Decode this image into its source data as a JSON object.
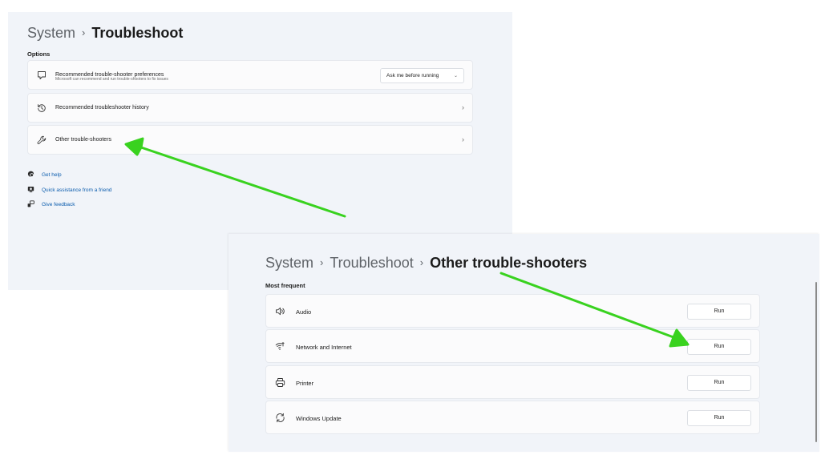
{
  "panel_a": {
    "breadcrumb": {
      "root": "System",
      "separator": "›",
      "current": "Troubleshoot"
    },
    "section_label": "Options",
    "cards": {
      "prefs": {
        "title": "Recommended trouble-shooter preferences",
        "subtitle": "Microsoft can recommend and run trouble-shooters to fix issues",
        "dropdown_value": "Ask me before running",
        "dropdown_caret": "⌄",
        "icon": "chat-bubble-icon"
      },
      "history": {
        "title": "Recommended troubleshooter history",
        "chevron": "›",
        "icon": "history-icon"
      },
      "others": {
        "title": "Other trouble-shooters",
        "chevron": "›",
        "icon": "wrench-icon"
      }
    },
    "links": {
      "help": "Get help",
      "assist": "Quick assistance from a friend",
      "feedback": "Give feedback"
    }
  },
  "panel_b": {
    "breadcrumb": {
      "root": "System",
      "separator1": "›",
      "middle": "Troubleshoot",
      "separator2": "›",
      "current": "Other trouble-shooters"
    },
    "section_label": "Most frequent",
    "rows": [
      {
        "label": "Audio",
        "button": "Run",
        "icon": "speaker-icon"
      },
      {
        "label": "Network and Internet",
        "button": "Run",
        "icon": "wifi-icon"
      },
      {
        "label": "Printer",
        "button": "Run",
        "icon": "printer-icon"
      },
      {
        "label": "Windows Update",
        "button": "Run",
        "icon": "sync-icon"
      }
    ]
  },
  "colors": {
    "arrow": "#39d21f",
    "link": "#0b5cad",
    "panel_bg": "#f1f4f9"
  }
}
